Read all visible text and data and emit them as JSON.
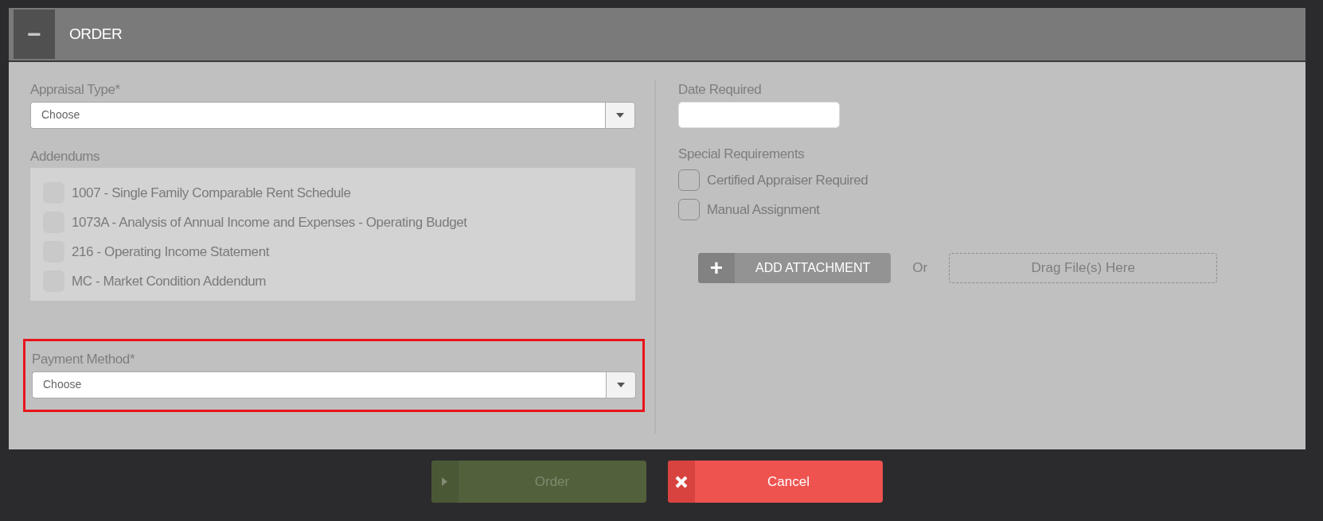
{
  "panel": {
    "title": "ORDER",
    "collapse_icon": "−"
  },
  "left": {
    "appraisal_type": {
      "label": "Appraisal Type*",
      "placeholder": "Choose"
    },
    "addendums": {
      "label": "Addendums",
      "items": [
        {
          "label": "1007 - Single Family Comparable Rent Schedule",
          "checked": false,
          "disabled": true
        },
        {
          "label": "1073A - Analysis of Annual Income and Expenses - Operating Budget",
          "checked": false,
          "disabled": true
        },
        {
          "label": "216 - Operating Income Statement",
          "checked": false,
          "disabled": true
        },
        {
          "label": "MC - Market Condition Addendum",
          "checked": false,
          "disabled": true
        }
      ]
    },
    "payment_method": {
      "label": "Payment Method*",
      "placeholder": "Choose",
      "highlighted": true
    }
  },
  "right": {
    "date_required": {
      "label": "Date Required"
    },
    "special_requirements": {
      "label": "Special Requirements",
      "items": [
        {
          "label": "Certified Appraiser Required",
          "checked": false
        },
        {
          "label": "Manual Assignment",
          "checked": false
        }
      ]
    },
    "attachment": {
      "button": "ADD ATTACHMENT",
      "button_icon": "+",
      "or": "Or",
      "drop_zone": "Drag File(s) Here"
    }
  },
  "actions": [
    {
      "kind": "order",
      "label": "Order",
      "disabled": true
    },
    {
      "kind": "cancel",
      "label": "Cancel",
      "disabled": false
    }
  ]
}
